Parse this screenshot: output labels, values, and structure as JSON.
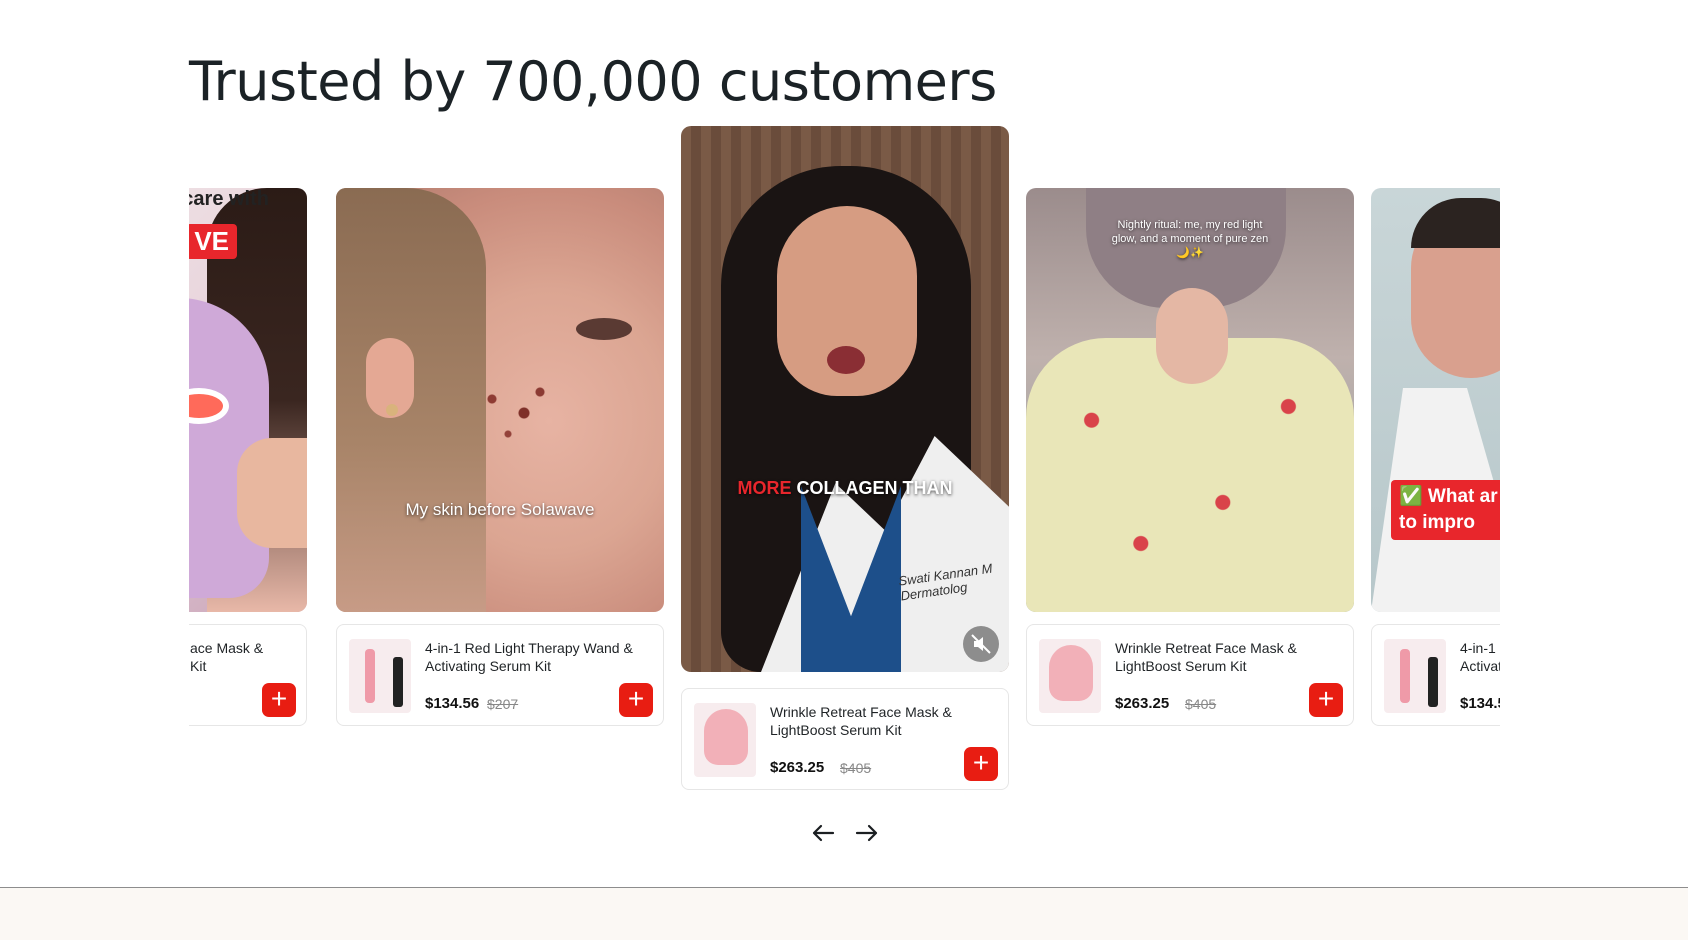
{
  "section": {
    "title": "Trusted by 700,000 customers"
  },
  "colors": {
    "accent": "#e81d12",
    "footer": "#fbf8f4"
  },
  "cards": [
    {
      "overlay_top": "ncare with",
      "overlay_badge": "VE",
      "product_name": "ace Mask &\nKit"
    },
    {
      "overlay": "My skin before Solawave",
      "product_name": "4-in-1 Red Light Therapy Wand & Activating Serum Kit",
      "price": "$134.56",
      "compare_price": "$207"
    },
    {
      "overlay_a": "MORE",
      "overlay_b": "COLLAGEN THAN",
      "coat_text": "Swati Kannan M\nDermatolog",
      "product_name": "Wrinkle Retreat Face Mask & LightBoost Serum Kit",
      "price": "$263.25",
      "compare_price": "$405"
    },
    {
      "overlay": "Nightly ritual: me, my red light glow, and a moment of pure zen🌙✨",
      "product_name": "Wrinkle Retreat Face Mask & LightBoost Serum Kit",
      "price": "$263.25",
      "compare_price": "$405"
    },
    {
      "overlay": "✅ What ar\nto impro",
      "product_name": "4-in-1\nActivat",
      "price": "$134.5"
    }
  ],
  "nav": {
    "prev_icon": "arrow-left-icon",
    "next_icon": "arrow-right-icon"
  }
}
